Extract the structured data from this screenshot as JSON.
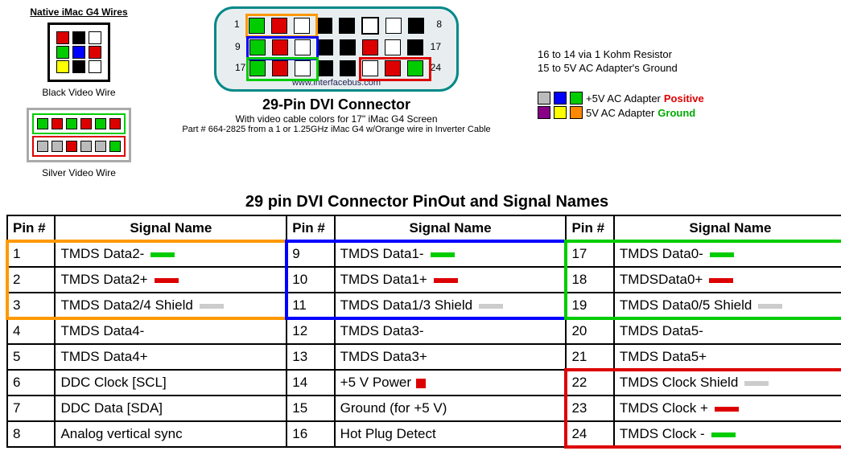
{
  "native_title": "Native iMac G4 Wires",
  "black_caption": "Black Video Wire",
  "silver_caption": "Silver Video Wire",
  "connector": {
    "url": "www.interfacebus.com",
    "title": "29-Pin DVI Connector",
    "sub1": "With video cable colors for 17\" iMac G4 Screen",
    "sub2": "Part # 664-2825 from a 1 or 1.25GHz iMac G4 w/Orange wire in Inverter Cable",
    "row_labels": {
      "l1": "1",
      "r1": "8",
      "l2": "9",
      "r2": "17",
      "l3": "17",
      "r3": "24"
    }
  },
  "notes": {
    "n1": "16 to 14 via 1 Kohm Resistor",
    "n2": "15 to 5V AC Adapter's Ground"
  },
  "legend": {
    "pos": "+5V AC Adapter ",
    "pos_word": "Positive",
    "gnd": "5V AC Adapter ",
    "gnd_word": "Ground"
  },
  "main_title": "29 pin DVI Connector PinOut and Signal Names",
  "headers": {
    "pin": "Pin #",
    "sig": "Signal Name"
  },
  "pins": {
    "1": {
      "name": "TMDS Data2-",
      "color": "#0c0"
    },
    "2": {
      "name": "TMDS Data2+",
      "color": "#d00"
    },
    "3": {
      "name": "TMDS Data2/4 Shield",
      "color": "#ccc"
    },
    "4": {
      "name": "TMDS Data4-",
      "color": ""
    },
    "5": {
      "name": "TMDS Data4+",
      "color": ""
    },
    "6": {
      "name": "DDC Clock [SCL]",
      "color": ""
    },
    "7": {
      "name": "DDC Data [SDA]",
      "color": ""
    },
    "8": {
      "name": "Analog vertical sync",
      "color": ""
    },
    "9": {
      "name": "TMDS Data1-",
      "color": "#0c0"
    },
    "10": {
      "name": "TMDS Data1+",
      "color": "#d00"
    },
    "11": {
      "name": "TMDS Data1/3 Shield",
      "color": "#ccc"
    },
    "12": {
      "name": "TMDS Data3-",
      "color": ""
    },
    "13": {
      "name": "TMDS Data3+",
      "color": ""
    },
    "14": {
      "name": "+5 V Power",
      "sq": "#d00"
    },
    "15": {
      "name": "Ground (for +5 V)",
      "color": ""
    },
    "16": {
      "name": "Hot Plug Detect",
      "color": ""
    },
    "17": {
      "name": "TMDS Data0-",
      "color": "#0c0"
    },
    "18": {
      "name": "TMDSData0+",
      "color": "#d00"
    },
    "19": {
      "name": "TMDS Data0/5 Shield",
      "color": "#ccc"
    },
    "20": {
      "name": "TMDS Data5-",
      "color": ""
    },
    "21": {
      "name": "TMDS Data5+",
      "color": ""
    },
    "22": {
      "name": "TMDS Clock Shield",
      "color": "#ccc"
    },
    "23": {
      "name": "TMDS Clock +",
      "color": "#d00"
    },
    "24": {
      "name": "TMDS Clock -",
      "color": "#0c0"
    }
  },
  "highlight_groups": [
    {
      "pins": [
        "1",
        "2",
        "3"
      ],
      "border": "#f90"
    },
    {
      "pins": [
        "9",
        "10",
        "11"
      ],
      "border": "#00f"
    },
    {
      "pins": [
        "17",
        "18",
        "19"
      ],
      "border": "#0c0"
    },
    {
      "pins": [
        "22",
        "23",
        "24"
      ],
      "border": "#d00"
    }
  ]
}
